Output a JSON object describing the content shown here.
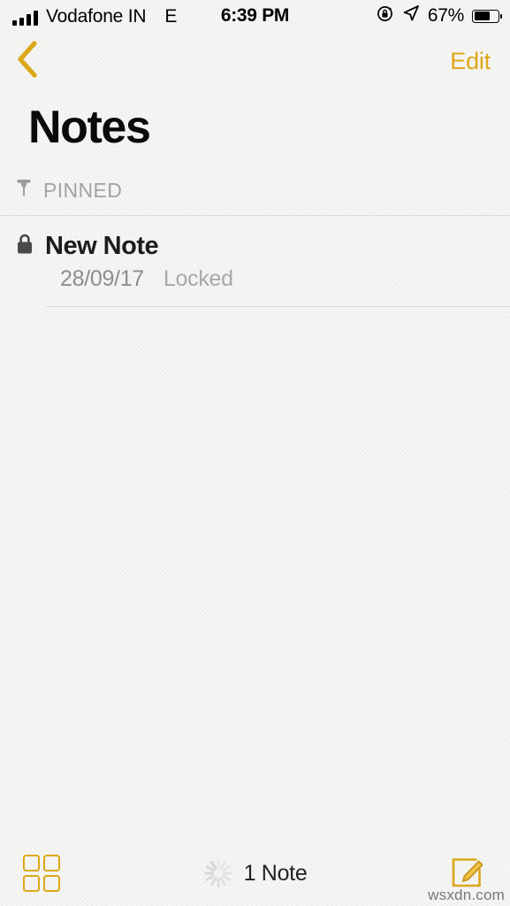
{
  "status_bar": {
    "carrier": "Vodafone IN",
    "network_type": "E",
    "time": "6:39 PM",
    "battery_percent": "67%",
    "battery_level": 67,
    "signal_bars": 4,
    "icons": [
      "signal-bars-icon",
      "rotation-lock-icon",
      "location-arrow-icon",
      "battery-icon"
    ]
  },
  "navbar": {
    "back_label": "",
    "edit_label": "Edit",
    "accent_color": "#e0a818"
  },
  "page_title": "Notes",
  "sections": [
    {
      "header": "PINNED",
      "icon": "pin-icon",
      "notes": [
        {
          "title": "New Note",
          "date": "28/09/17",
          "status": "Locked",
          "icon": "lock-icon"
        }
      ]
    }
  ],
  "toolbar": {
    "grid_view_label": "",
    "note_count": "1 Note",
    "compose_label": "",
    "accent_color": "#dca81a"
  },
  "watermark": "wsxdn.com"
}
